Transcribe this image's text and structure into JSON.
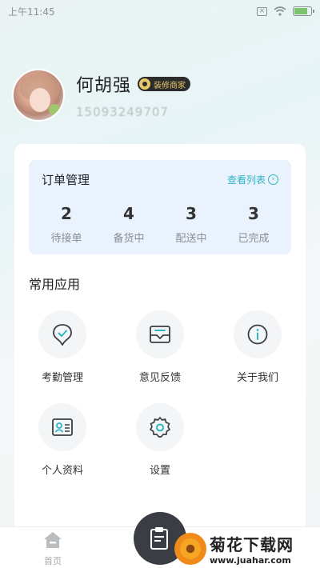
{
  "status_bar": {
    "time": "上午11:45",
    "battery_level": 0.8
  },
  "profile": {
    "name": "何胡强",
    "role_badge": "装修商家",
    "phone": "15093249707"
  },
  "orders": {
    "title": "订单管理",
    "link": "查看列表",
    "stats": [
      {
        "value": "2",
        "label": "待接单"
      },
      {
        "value": "4",
        "label": "备货中"
      },
      {
        "value": "3",
        "label": "配送中"
      },
      {
        "value": "3",
        "label": "已完成"
      }
    ]
  },
  "apps": {
    "title": "常用应用",
    "items": [
      {
        "label": "考勤管理",
        "icon": "checkin-icon"
      },
      {
        "label": "意见反馈",
        "icon": "feedback-mail-icon"
      },
      {
        "label": "关于我们",
        "icon": "info-icon"
      },
      {
        "label": "个人资料",
        "icon": "id-card-icon"
      },
      {
        "label": "设置",
        "icon": "gear-icon"
      }
    ]
  },
  "tabbar": {
    "home_label": "首页"
  },
  "watermark": {
    "main": "菊花下载网",
    "sub": "www.juahar.com"
  },
  "colors": {
    "accent": "#2db6c5",
    "orders_bg": "#eaf2fd",
    "badge_bg": "#2c2c2c",
    "badge_text": "#e8c76a"
  }
}
